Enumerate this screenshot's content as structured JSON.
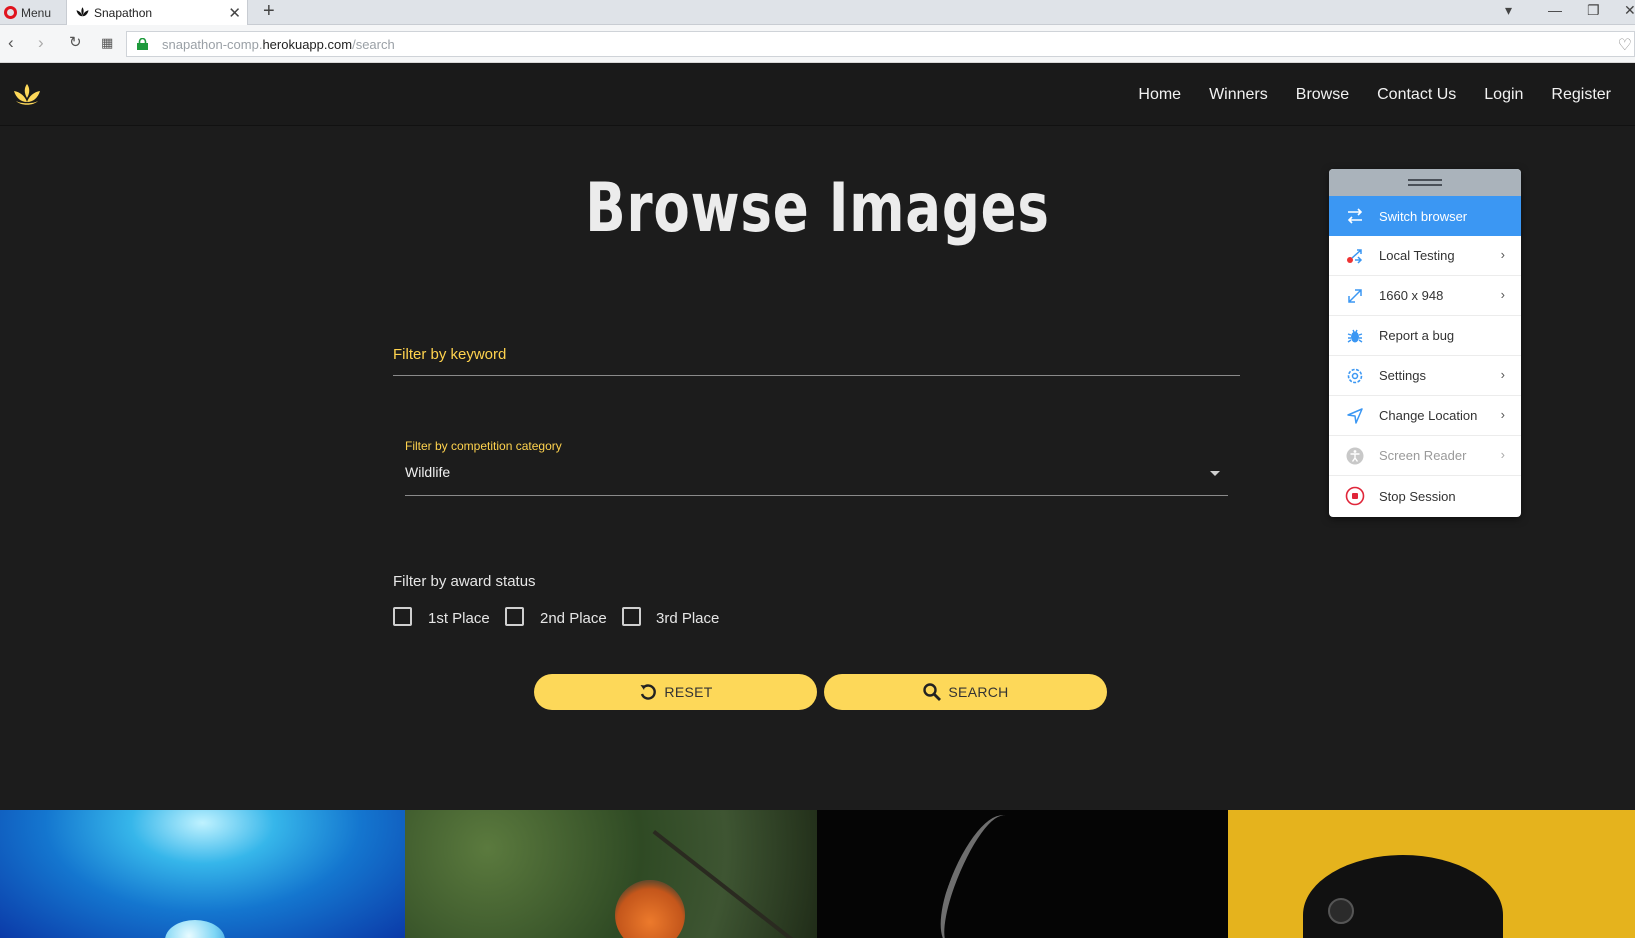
{
  "browser": {
    "menu_label": "Menu",
    "tab_title": "Snapathon",
    "url_prefix": "snapathon-comp.",
    "url_host": "herokuapp.com",
    "url_path": "/search"
  },
  "nav": {
    "links": [
      "Home",
      "Winners",
      "Browse",
      "Contact Us",
      "Login",
      "Register"
    ]
  },
  "page": {
    "title": "Browse Images",
    "keyword_placeholder": "Filter by keyword",
    "category_label": "Filter by competition category",
    "category_value": "Wildlife",
    "award_label": "Filter by award status",
    "award_options": [
      "1st Place",
      "2nd Place",
      "3rd Place"
    ],
    "reset_label": "RESET",
    "search_label": "SEARCH"
  },
  "panel": {
    "items": [
      {
        "label": "Switch browser",
        "icon": "switch-icon"
      },
      {
        "label": "Local Testing",
        "icon": "local-testing-icon"
      },
      {
        "label": "1660 x 948",
        "icon": "resize-icon"
      },
      {
        "label": "Report a bug",
        "icon": "bug-icon"
      },
      {
        "label": "Settings",
        "icon": "gear-icon"
      },
      {
        "label": "Change Location",
        "icon": "location-arrow-icon"
      },
      {
        "label": "Screen Reader",
        "icon": "accessibility-icon"
      },
      {
        "label": "Stop Session",
        "icon": "stop-icon"
      }
    ]
  },
  "colors": {
    "accent_yellow": "#fdd859",
    "label_yellow": "#ffd34e",
    "panel_active": "#3b97f3",
    "background": "#1c1c1c"
  }
}
